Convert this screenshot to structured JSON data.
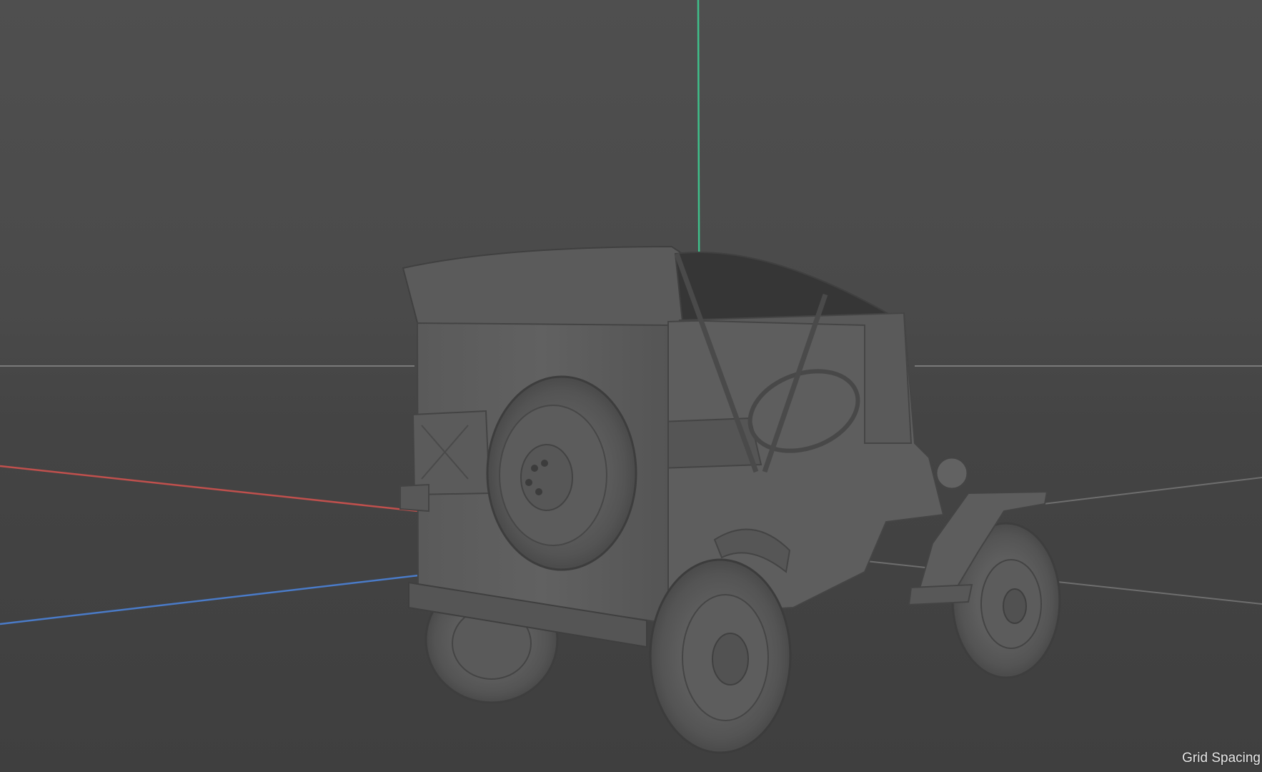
{
  "viewport": {
    "hud": {
      "grid_spacing_label": "Grid Spacing"
    },
    "axes": {
      "x_axis_color": "#c0504d",
      "y_axis_color": "#3fbf8a",
      "z_axis_color": "#4a7bc8",
      "grid_line_color": "#7a7a7a"
    },
    "model": {
      "type": "jeep",
      "shading": "clay"
    },
    "background_color": "#484848"
  }
}
